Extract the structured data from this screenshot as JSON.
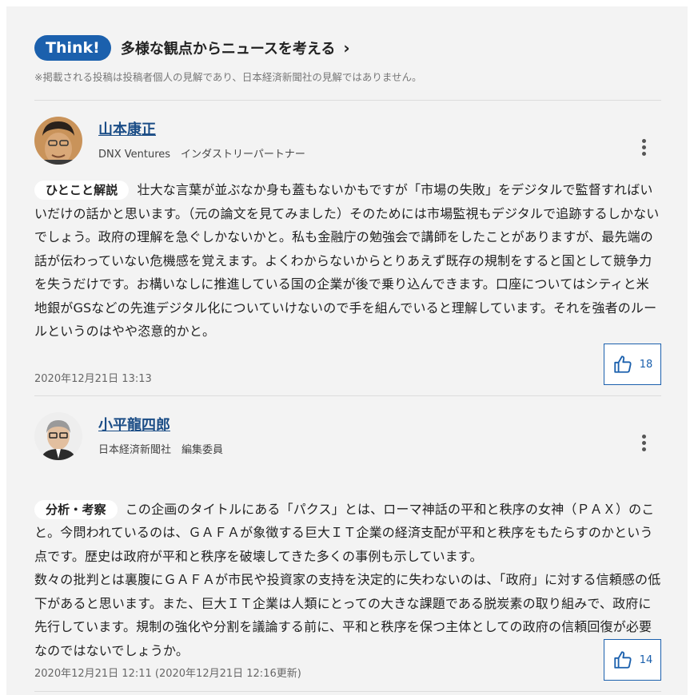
{
  "header": {
    "badge": "Think!",
    "title": "多様な観点からニュースを考える",
    "disclaimer": "※掲載される投稿は投稿者個人の見解であり、日本経済新聞社の見解ではありません。"
  },
  "comments": [
    {
      "name": "山本康正",
      "affiliation": "DNX Ventures　インダストリーパートナー",
      "tag": "ひとこと解説",
      "text": "壮大な言葉が並ぶなか身も蓋もないかもですが「市場の失敗」をデジタルで監督すればいいだけの話かと思います。（元の論文を見てみました）そのためには市場監視もデジタルで追跡するしかないでしょう。政府の理解を急ぐしかないかと。私も金融庁の勉強会で講師をしたことがありますが、最先端の話が伝わっていない危機感を覚えます。よくわからないからとりあえず既存の規制をすると国として競争力を失うだけです。お構いなしに推進している国の企業が後で乗り込んできます。口座についてはシティと米地銀がGSなどの先進デジタル化についていけないので手を組んでいると理解しています。それを強者のルールというのはやや恣意的かと。",
      "date": "2020年12月21日 13:13",
      "likes": "18"
    },
    {
      "name": "小平龍四郎",
      "affiliation": "日本経済新聞社　編集委員",
      "tag": "分析・考察",
      "text": "この企画のタイトルにある「パクス」とは、ローマ神話の平和と秩序の女神（ＰＡＸ）のこと。今問われているのは、ＧＡＦＡが象徴する巨大ＩＴ企業の経済支配が平和と秩序をもたらすのかという点です。歴史は政府が平和と秩序を破壊してきた多くの事例も示しています。\n数々の批判とは裏腹にＧＡＦＡが市民や投資家の支持を決定的に失わないのは、「政府」に対する信頼感の低下があると思います。また、巨大ＩＴ企業は人類にとっての大きな課題である脱炭素の取り組みで、政府に先行しています。規制の強化や分割を議論する前に、平和と秩序を保つ主体としての政府の信頼回復が必要なのではないでしょうか。",
      "date": "2020年12月21日 12:11 (2020年12月21日 12:16更新)",
      "likes": "14"
    }
  ],
  "colors": {
    "accent": "#1b60ad",
    "name_link": "#1b4d86",
    "panel_bg": "#f3f3f3"
  },
  "icons": {
    "like": "thumbs-up-icon",
    "menu": "kebab-menu-icon",
    "more": "chevron-right-icon"
  }
}
